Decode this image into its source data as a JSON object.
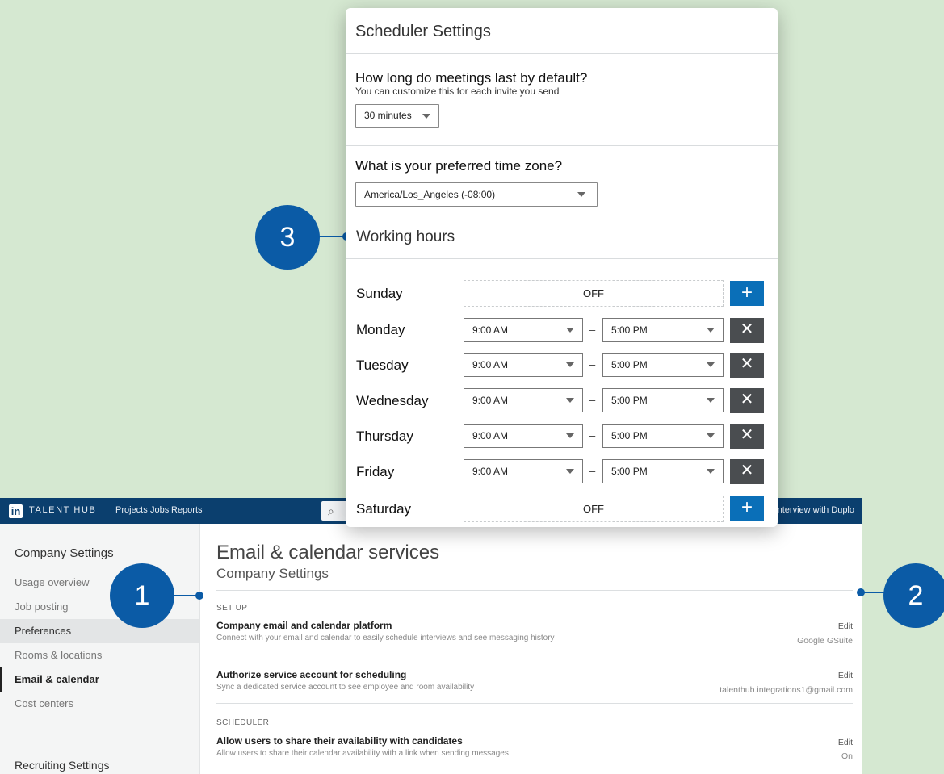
{
  "app": {
    "brand": "TALENT HUB",
    "logo_text": "in",
    "nav": [
      "Projects",
      "Jobs",
      "Reports"
    ],
    "topbar_right": "ST-interview with Duplo",
    "sidebar": {
      "company_heading": "Company Settings",
      "items": [
        "Usage overview",
        "Job posting",
        "Preferences",
        "Rooms & locations",
        "Email & calendar",
        "Cost centers"
      ],
      "recruiting_heading": "Recruiting Settings"
    },
    "main": {
      "title": "Email & calendar services",
      "subtitle": "Company Settings",
      "setup_label": "SET UP",
      "rows": [
        {
          "title": "Company email and calendar platform",
          "desc": "Connect with your email and calendar to easily schedule interviews and see messaging history",
          "action": "Edit",
          "value": "Google GSuite"
        },
        {
          "title": "Authorize service account for scheduling",
          "desc": "Sync a dedicated service account to see employee and room availability",
          "action": "Edit",
          "value": "talenthub.integrations1@gmail.com"
        }
      ],
      "scheduler_label": "SCHEDULER",
      "scheduler_row": {
        "title": "Allow users to share their availability with candidates",
        "desc": "Allow users to share their calendar availability with a link when sending messages",
        "action": "Edit",
        "value": "On"
      }
    }
  },
  "modal": {
    "title": "Scheduler Settings",
    "duration_question": "How long do meetings last by default?",
    "duration_help": "You can customize this for each invite you send",
    "duration_value": "30 minutes",
    "timezone_question": "What is your preferred time zone?",
    "timezone_value": "America/Los_Angeles (-08:00)",
    "working_hours_title": "Working hours",
    "days": [
      {
        "name": "Sunday",
        "off": true,
        "off_label": "OFF",
        "action": "+"
      },
      {
        "name": "Monday",
        "off": false,
        "start": "9:00 AM",
        "end": "5:00 PM",
        "action": "✕"
      },
      {
        "name": "Tuesday",
        "off": false,
        "start": "9:00 AM",
        "end": "5:00 PM",
        "action": "✕"
      },
      {
        "name": "Wednesday",
        "off": false,
        "start": "9:00 AM",
        "end": "5:00 PM",
        "action": "✕"
      },
      {
        "name": "Thursday",
        "off": false,
        "start": "9:00 AM",
        "end": "5:00 PM",
        "action": "✕"
      },
      {
        "name": "Friday",
        "off": false,
        "start": "9:00 AM",
        "end": "5:00 PM",
        "action": "✕"
      },
      {
        "name": "Saturday",
        "off": true,
        "off_label": "OFF",
        "action": "+"
      }
    ],
    "range_separator": "–"
  },
  "callouts": [
    "1",
    "2",
    "3"
  ],
  "colors": {
    "accent": "#0b5ba6",
    "topbar": "#0b3f6e",
    "add_button": "#0a6fb8",
    "remove_button": "#4a4d50",
    "background": "#d5e8d1"
  }
}
